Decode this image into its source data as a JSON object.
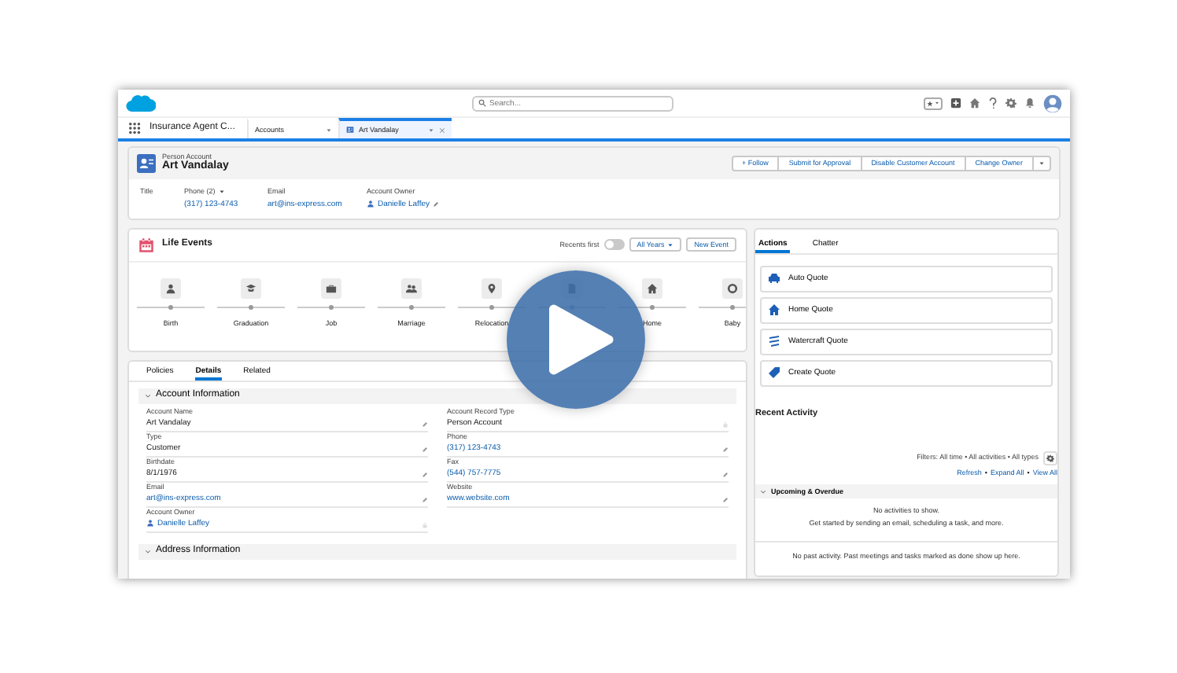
{
  "global_header": {
    "search": {
      "placeholder": "Search..."
    }
  },
  "nav": {
    "app_name": "Insurance Agent C...",
    "tabs": [
      {
        "label": "Accounts",
        "kind": "object",
        "selected": false
      },
      {
        "label": "Art Vandalay",
        "kind": "record",
        "selected": true
      }
    ]
  },
  "record": {
    "object_type": "Person Account",
    "name": "Art Vandalay",
    "buttons": [
      "+ Follow",
      "Submit for Approval",
      "Disable Customer Account",
      "Change Owner"
    ],
    "fields": [
      {
        "label": "Title",
        "kind": "plain"
      },
      {
        "label": "Phone (2)",
        "value": "(317) 123-4743",
        "kind": "dropdown"
      },
      {
        "label": "Email",
        "value": "art@ins-express.com",
        "kind": "link"
      },
      {
        "label": "Account Owner",
        "value": "Danielle Laffey",
        "kind": "user"
      }
    ]
  },
  "life_events": {
    "title": "Life Events",
    "toggle": {
      "label": "Recents first",
      "on": false
    },
    "filter": "All Years",
    "new_button": "New Event",
    "events": [
      {
        "label": "Birth",
        "kind": "person"
      },
      {
        "label": "Graduation",
        "kind": "graduate"
      },
      {
        "label": "Job",
        "kind": "briefcase"
      },
      {
        "label": "Marriage",
        "kind": "couple"
      },
      {
        "label": "Relocation",
        "kind": "pin"
      },
      {
        "kind": "document"
      },
      {
        "label": "Home",
        "kind": "house"
      },
      {
        "label": "Baby",
        "kind": "badge"
      }
    ]
  },
  "details": {
    "tabs": [
      {
        "label": "Policies",
        "selected": false
      },
      {
        "label": "Details",
        "selected": true
      },
      {
        "label": "Related",
        "selected": false
      }
    ],
    "sections": [
      {
        "title": "Account Information",
        "expanded": true,
        "fields": [
          {
            "label": "Account Name",
            "value": "Art Vandalay",
            "kind": "text",
            "editable": true
          },
          {
            "label": "Account Record Type",
            "value": "Person Account",
            "kind": "text",
            "editable": false
          },
          {
            "label": "Type",
            "value": "Customer",
            "kind": "text",
            "editable": true
          },
          {
            "label": "Phone",
            "value": "(317) 123-4743",
            "kind": "link",
            "editable": true
          },
          {
            "label": "Birthdate",
            "value": "8/1/1976",
            "kind": "text",
            "editable": true
          },
          {
            "label": "Fax",
            "value": "(544) 757-7775",
            "kind": "link",
            "editable": true
          },
          {
            "label": "Email",
            "value": "art@ins-express.com",
            "kind": "link",
            "editable": true
          },
          {
            "label": "Website",
            "value": "www.website.com",
            "kind": "link",
            "editable": true
          },
          {
            "label": "Account Owner",
            "value": "Danielle Laffey",
            "kind": "user",
            "editable": false
          }
        ]
      },
      {
        "title": "Address Information",
        "expanded": true
      }
    ]
  },
  "side": {
    "tabs": [
      {
        "label": "Actions",
        "selected": true
      },
      {
        "label": "Chatter",
        "selected": false
      }
    ],
    "actions": [
      {
        "label": "Auto Quote",
        "kind": "car"
      },
      {
        "label": "Home Quote",
        "kind": "house"
      },
      {
        "label": "Watercraft Quote",
        "kind": "wave"
      },
      {
        "label": "Create Quote",
        "kind": "tag"
      }
    ],
    "recent_activity": {
      "title": "Recent Activity",
      "filters": "Filters: All time • All activities • All types",
      "links": [
        "Refresh",
        "Expand All",
        "View All"
      ],
      "link_separator": "•",
      "upcoming": {
        "title": "Upcoming & Overdue",
        "expanded": true,
        "empty": "No activities to show.",
        "hint": "Get started by sending an email, scheduling a task, and more."
      },
      "past": "No past activity. Past meetings and tasks marked as done show up here."
    }
  }
}
